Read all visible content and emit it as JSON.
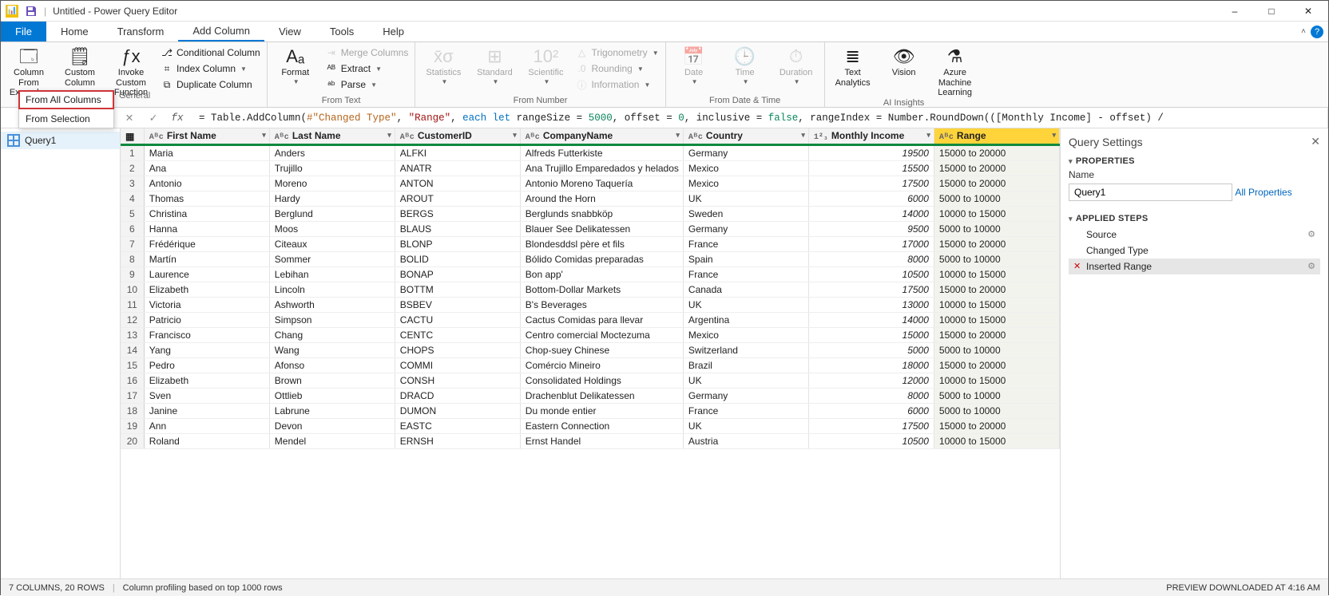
{
  "title": "Untitled - Power Query Editor",
  "menu": {
    "file": "File",
    "tabs": [
      "Home",
      "Transform",
      "Add Column",
      "View",
      "Tools",
      "Help"
    ],
    "active": "Add Column"
  },
  "ribbon": {
    "general": {
      "label": "General",
      "examples_btn": "Column From Examples",
      "custom_col": "Custom Column",
      "invoke_fn": "Invoke Custom Function",
      "conditional": "Conditional Column",
      "index": "Index Column",
      "duplicate": "Duplicate Column",
      "dropdown": {
        "all": "From All Columns",
        "sel": "From Selection"
      }
    },
    "fromtext": {
      "label": "From Text",
      "format": "Format",
      "merge": "Merge Columns",
      "extract": "Extract",
      "parse": "Parse"
    },
    "fromnumber": {
      "label": "From Number",
      "statistics": "Statistics",
      "standard": "Standard",
      "scientific": "Scientific",
      "trig": "Trigonometry",
      "round": "Rounding",
      "info": "Information"
    },
    "fromdate": {
      "label": "From Date & Time",
      "date": "Date",
      "time": "Time",
      "duration": "Duration"
    },
    "ai": {
      "label": "AI Insights",
      "text": "Text Analytics",
      "vision": "Vision",
      "aml": "Azure Machine Learning"
    }
  },
  "formula": {
    "prefix": "= Table.AddColumn(",
    "arg1": "#\"Changed Type\"",
    "arg2": "\"Range\"",
    "each": "each",
    "let": "let",
    "v1n": "rangeSize = ",
    "v1v": "5000",
    "v2n": ", offset = ",
    "v2v": "0",
    "v3n": ", inclusive = ",
    "v3v": "false",
    "v4": ", rangeIndex = Number.RoundDown(([Monthly Income] - offset) /"
  },
  "queries": {
    "q1": "Query1"
  },
  "columns": [
    "First Name",
    "Last Name",
    "CustomerID",
    "CompanyName",
    "Country",
    "Monthly Income",
    "Range"
  ],
  "rows": [
    [
      "Maria",
      "Anders",
      "ALFKI",
      "Alfreds Futterkiste",
      "Germany",
      "19500",
      "15000 to 20000"
    ],
    [
      "Ana",
      "Trujillo",
      "ANATR",
      "Ana Trujillo Emparedados y helados",
      "Mexico",
      "15500",
      "15000 to 20000"
    ],
    [
      "Antonio",
      "Moreno",
      "ANTON",
      "Antonio Moreno Taquería",
      "Mexico",
      "17500",
      "15000 to 20000"
    ],
    [
      "Thomas",
      "Hardy",
      "AROUT",
      "Around the Horn",
      "UK",
      "6000",
      "5000 to 10000"
    ],
    [
      "Christina",
      "Berglund",
      "BERGS",
      "Berglunds snabbköp",
      "Sweden",
      "14000",
      "10000 to 15000"
    ],
    [
      "Hanna",
      "Moos",
      "BLAUS",
      "Blauer See Delikatessen",
      "Germany",
      "9500",
      "5000 to 10000"
    ],
    [
      "Frédérique",
      "Citeaux",
      "BLONP",
      "Blondesddsl père et fils",
      "France",
      "17000",
      "15000 to 20000"
    ],
    [
      "Martín",
      "Sommer",
      "BOLID",
      "Bólido Comidas preparadas",
      "Spain",
      "8000",
      "5000 to 10000"
    ],
    [
      "Laurence",
      "Lebihan",
      "BONAP",
      "Bon app'",
      "France",
      "10500",
      "10000 to 15000"
    ],
    [
      "Elizabeth",
      "Lincoln",
      "BOTTM",
      "Bottom-Dollar Markets",
      "Canada",
      "17500",
      "15000 to 20000"
    ],
    [
      "Victoria",
      "Ashworth",
      "BSBEV",
      "B's Beverages",
      "UK",
      "13000",
      "10000 to 15000"
    ],
    [
      "Patricio",
      "Simpson",
      "CACTU",
      "Cactus Comidas para llevar",
      "Argentina",
      "14000",
      "10000 to 15000"
    ],
    [
      "Francisco",
      "Chang",
      "CENTC",
      "Centro comercial Moctezuma",
      "Mexico",
      "15000",
      "15000 to 20000"
    ],
    [
      "Yang",
      "Wang",
      "CHOPS",
      "Chop-suey Chinese",
      "Switzerland",
      "5000",
      "5000 to 10000"
    ],
    [
      "Pedro",
      "Afonso",
      "COMMI",
      "Comércio Mineiro",
      "Brazil",
      "18000",
      "15000 to 20000"
    ],
    [
      "Elizabeth",
      "Brown",
      "CONSH",
      "Consolidated Holdings",
      "UK",
      "12000",
      "10000 to 15000"
    ],
    [
      "Sven",
      "Ottlieb",
      "DRACD",
      "Drachenblut Delikatessen",
      "Germany",
      "8000",
      "5000 to 10000"
    ],
    [
      "Janine",
      "Labrune",
      "DUMON",
      "Du monde entier",
      "France",
      "6000",
      "5000 to 10000"
    ],
    [
      "Ann",
      "Devon",
      "EASTC",
      "Eastern Connection",
      "UK",
      "17500",
      "15000 to 20000"
    ],
    [
      "Roland",
      "Mendel",
      "ERNSH",
      "Ernst Handel",
      "Austria",
      "10500",
      "10000 to 15000"
    ]
  ],
  "settings": {
    "title": "Query Settings",
    "props": "PROPERTIES",
    "name_label": "Name",
    "name_value": "Query1",
    "all_props": "All Properties",
    "steps_label": "APPLIED STEPS",
    "steps": [
      "Source",
      "Changed Type",
      "Inserted Range"
    ]
  },
  "status": {
    "left1": "7 COLUMNS, 20 ROWS",
    "left2": "Column profiling based on top 1000 rows",
    "right": "PREVIEW DOWNLOADED AT 4:16 AM"
  }
}
